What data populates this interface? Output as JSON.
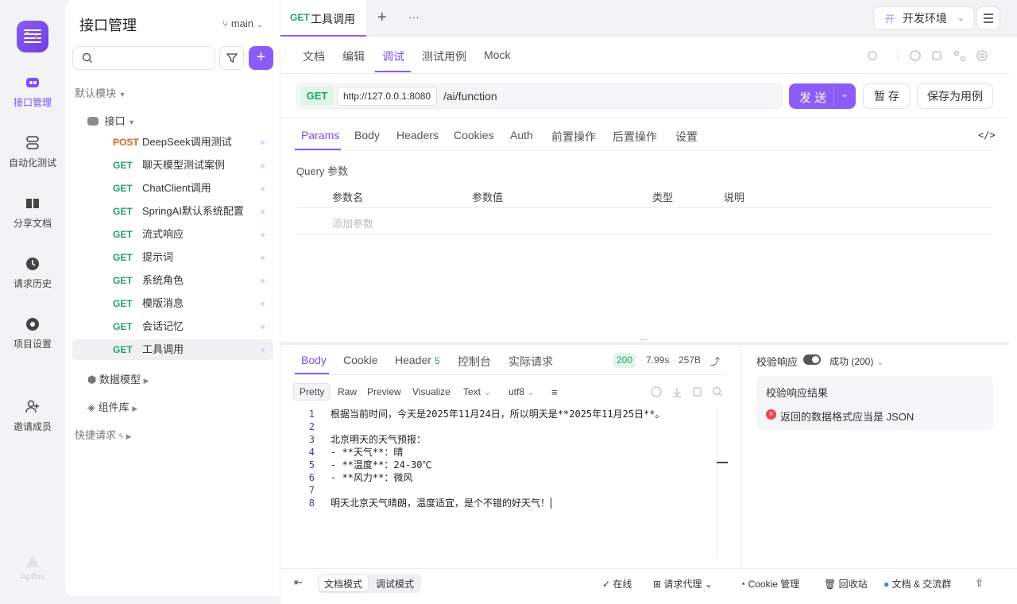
{
  "rail": {
    "items": [
      {
        "label": "接口管理",
        "icon": "api-icon"
      },
      {
        "label": "自动化测试",
        "icon": "automation-icon"
      },
      {
        "label": "分享文档",
        "icon": "book-icon"
      },
      {
        "label": "请求历史",
        "icon": "clock-icon"
      },
      {
        "label": "项目设置",
        "icon": "settings-icon"
      },
      {
        "label": "邀请成员",
        "icon": "user-plus-icon"
      }
    ],
    "brand": "Apifox"
  },
  "sidebar": {
    "title": "接口管理",
    "branch": "main",
    "default_module": "默认模块",
    "folder": "接口",
    "endpoints": [
      {
        "method": "POST",
        "name": "DeepSeek调用测试"
      },
      {
        "method": "GET",
        "name": "聊天模型测试案例"
      },
      {
        "method": "GET",
        "name": "ChatClient调用"
      },
      {
        "method": "GET",
        "name": "SpringAI默认系统配置"
      },
      {
        "method": "GET",
        "name": "流式响应"
      },
      {
        "method": "GET",
        "name": "提示词"
      },
      {
        "method": "GET",
        "name": "系统角色"
      },
      {
        "method": "GET",
        "name": "模版消息"
      },
      {
        "method": "GET",
        "name": "会话记忆"
      },
      {
        "method": "GET",
        "name": "工具调用"
      }
    ],
    "data_model": "数据模型",
    "components": "组件库",
    "quick_request": "快捷请求"
  },
  "tabbar": {
    "tab_method": "GET",
    "tab_title": "工具调用",
    "plus": "+",
    "more": "···",
    "env_badge": "开",
    "env_label": "开发环境"
  },
  "subtabs": [
    "文档",
    "编辑",
    "调试",
    "测试用例",
    "Mock"
  ],
  "request": {
    "method": "GET",
    "host": "http://127.0.0.1:8080",
    "path": "/ai/function",
    "send": "发 送",
    "save": "暂 存",
    "save_case": "保存为用例"
  },
  "param_tabs": [
    "Params",
    "Body",
    "Headers",
    "Cookies",
    "Auth",
    "前置操作",
    "后置操作",
    "设置"
  ],
  "query": {
    "title": "Query 参数",
    "columns": [
      "参数名",
      "参数值",
      "类型",
      "说明"
    ],
    "add_placeholder": "添加参数"
  },
  "response": {
    "tabs": [
      "Body",
      "Cookie",
      "Header",
      "控制台",
      "实际请求"
    ],
    "header_count": "5",
    "status": "200",
    "time": "7.99s",
    "size": "257B",
    "views": [
      "Pretty",
      "Raw",
      "Preview",
      "Visualize"
    ],
    "format": "Text",
    "encoding": "utf8",
    "lines": [
      {
        "n": "1",
        "text": "根据当前时间，今天是2025年11月24日，所以明天是**2025年11月25日**。"
      },
      {
        "n": "2",
        "text": ""
      },
      {
        "n": "3",
        "text": "北京明天的天气预报："
      },
      {
        "n": "4",
        "text": "- **天气**：晴"
      },
      {
        "n": "5",
        "text": "- **温度**：24-30℃"
      },
      {
        "n": "6",
        "text": "- **风力**：微风"
      },
      {
        "n": "7",
        "text": ""
      },
      {
        "n": "8",
        "text": "明天北京天气晴朗，温度适宜，是个不错的好天气！"
      }
    ]
  },
  "validation": {
    "label": "校验响应",
    "result_select": "成功 (200)",
    "card_title": "校验响应结果",
    "error": "返回的数据格式应当是 JSON"
  },
  "footer": {
    "doc_mode": "文档模式",
    "debug_mode": "调试模式",
    "online": "在线",
    "proxy": "请求代理",
    "cookie": "Cookie 管理",
    "trash": "回收站",
    "community": "文档 & 交流群"
  },
  "colors": {
    "accent": "#8b5cf6",
    "get": "#21a366",
    "post": "#e8602c"
  }
}
